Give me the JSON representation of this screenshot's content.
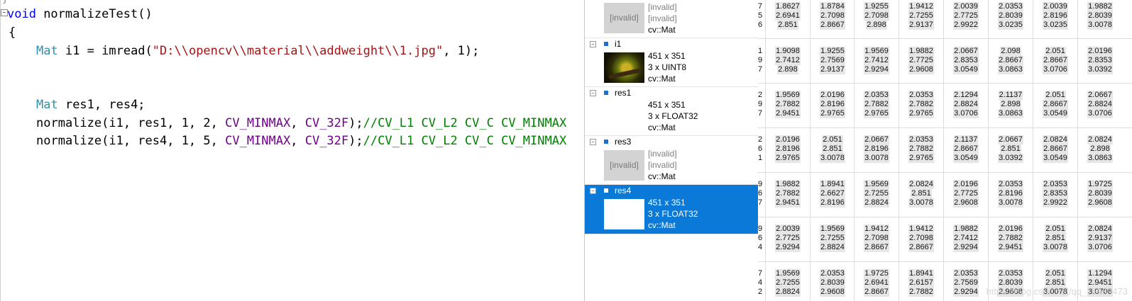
{
  "editor": {
    "lines": {
      "l1": {
        "kw": "void",
        "rest": " normalizeTest()"
      },
      "l2": "{",
      "l3": {
        "type": "Mat",
        "a": " i1 = imread(",
        "str": "\"D:\\\\opencv\\\\material\\\\addweight\\\\1.jpg\"",
        "b": ", 1);"
      },
      "l4": {
        "type": "Mat",
        "rest": " res1, res4;"
      },
      "l5": {
        "a": "normalize(i1, res1, 1, 2, ",
        "m1": "CV_MINMAX",
        "c": ", ",
        "m2": "CV_32F",
        "d": ");",
        "cmt": "//CV_L1 CV_L2 CV_C CV_MINMAX"
      },
      "l6": {
        "a": "normalize(i1, res4, 1, 5, ",
        "m1": "CV_MINMAX",
        "c": ", ",
        "m2": "CV_32F",
        "d": ");",
        "cmt": "//CV_L1 CV_L2 CV_C CV_MINMAX"
      }
    }
  },
  "watch": {
    "items": [
      {
        "name": "",
        "thumb": "[invalid]",
        "l1": "[invalid]",
        "l2": "[invalid]",
        "l3": "cv::Mat"
      },
      {
        "name": "i1",
        "thumb": "",
        "l1": "451 x 351",
        "l2": "3 x UINT8",
        "l3": "cv::Mat"
      },
      {
        "name": "res1",
        "thumb": "",
        "l1": "451 x 351",
        "l2": "3 x FLOAT32",
        "l3": "cv::Mat"
      },
      {
        "name": "res3",
        "thumb": "[invalid]",
        "l1": "[invalid]",
        "l2": "[invalid]",
        "l3": "cv::Mat"
      },
      {
        "name": "res4",
        "thumb": "",
        "l1": "451 x 351",
        "l2": "3 x FLOAT32",
        "l3": "cv::Mat"
      }
    ]
  },
  "matrix": {
    "edge_digits": [
      [
        "7",
        "5",
        "6"
      ],
      [
        "1",
        "9",
        "7"
      ],
      [
        "2",
        "9",
        "7"
      ],
      [
        "2",
        "6",
        "1"
      ],
      [
        "9",
        "6",
        "7"
      ],
      [
        "9",
        "6",
        "4"
      ],
      [
        "7",
        "4",
        "2"
      ]
    ],
    "rows": [
      [
        [
          "1.8627",
          "2.6941",
          "2.851"
        ],
        [
          "1.8784",
          "2.7098",
          "2.8667"
        ],
        [
          "1.9255",
          "2.7098",
          "2.898"
        ],
        [
          "1.9412",
          "2.7255",
          "2.9137"
        ],
        [
          "2.0039",
          "2.7725",
          "2.9922"
        ],
        [
          "2.0353",
          "2.8039",
          "3.0235"
        ],
        [
          "2.0039",
          "2.8196",
          "3.0235"
        ],
        [
          "1.9882",
          "2.8039",
          "3.0078"
        ]
      ],
      [
        [
          "1.9098",
          "2.7412",
          "2.898"
        ],
        [
          "1.9255",
          "2.7569",
          "2.9137"
        ],
        [
          "1.9569",
          "2.7412",
          "2.9294"
        ],
        [
          "1.9882",
          "2.7725",
          "2.9608"
        ],
        [
          "2.0667",
          "2.8353",
          "3.0549"
        ],
        [
          "2.098",
          "2.8667",
          "3.0863"
        ],
        [
          "2.051",
          "2.8667",
          "3.0706"
        ],
        [
          "2.0196",
          "2.8353",
          "3.0392"
        ]
      ],
      [
        [
          "1.9569",
          "2.7882",
          "2.9451"
        ],
        [
          "2.0196",
          "2.8196",
          "2.9765"
        ],
        [
          "2.0353",
          "2.7882",
          "2.9765"
        ],
        [
          "2.0353",
          "2.7882",
          "2.9765"
        ],
        [
          "2.1294",
          "2.8824",
          "3.0706"
        ],
        [
          "2.1137",
          "2.898",
          "3.0863"
        ],
        [
          "2.051",
          "2.8667",
          "3.0549"
        ],
        [
          "2.0667",
          "2.8824",
          "3.0706"
        ]
      ],
      [
        [
          "2.0196",
          "2.8196",
          "2.9765"
        ],
        [
          "2.051",
          "2.851",
          "3.0078"
        ],
        [
          "2.0667",
          "2.8196",
          "3.0078"
        ],
        [
          "2.0353",
          "2.7882",
          "2.9765"
        ],
        [
          "2.1137",
          "2.8667",
          "3.0549"
        ],
        [
          "2.0667",
          "2.851",
          "3.0392"
        ],
        [
          "2.0824",
          "2.8667",
          "3.0549"
        ],
        [
          "2.0824",
          "2.898",
          "3.0863"
        ]
      ],
      [
        [
          "1.9882",
          "2.7882",
          "2.9451"
        ],
        [
          "1.8941",
          "2.6627",
          "2.8196"
        ],
        [
          "1.9569",
          "2.7255",
          "2.8824"
        ],
        [
          "2.0824",
          "2.851",
          "3.0078"
        ],
        [
          "2.0196",
          "2.7725",
          "2.9608"
        ],
        [
          "2.0353",
          "2.8196",
          "3.0078"
        ],
        [
          "2.0353",
          "2.8353",
          "2.9922"
        ],
        [
          "1.9725",
          "2.8039",
          "2.9608"
        ]
      ],
      [
        [
          "2.0039",
          "2.7725",
          "2.9294"
        ],
        [
          "1.9569",
          "2.7255",
          "2.8824"
        ],
        [
          "1.9412",
          "2.7098",
          "2.8667"
        ],
        [
          "1.9412",
          "2.7098",
          "2.8667"
        ],
        [
          "1.9882",
          "2.7412",
          "2.9294"
        ],
        [
          "2.0196",
          "2.7882",
          "2.9451"
        ],
        [
          "2.051",
          "2.851",
          "3.0078"
        ],
        [
          "2.0824",
          "2.9137",
          "3.0706"
        ]
      ],
      [
        [
          "1.9569",
          "2.7255",
          "2.8824"
        ],
        [
          "2.0353",
          "2.8039",
          "2.9608"
        ],
        [
          "1.9725",
          "2.6941",
          "2.8667"
        ],
        [
          "1.8941",
          "2.6157",
          "2.7882"
        ],
        [
          "2.0353",
          "2.7569",
          "2.9294"
        ],
        [
          "2.0353",
          "2.8039",
          "2.9608"
        ],
        [
          "2.051",
          "2.851",
          "3.0078"
        ],
        [
          "1.1294",
          "2.9451",
          "3.0706"
        ]
      ]
    ],
    "watermark": "https://blog.csdn.net/qq_15989473"
  }
}
